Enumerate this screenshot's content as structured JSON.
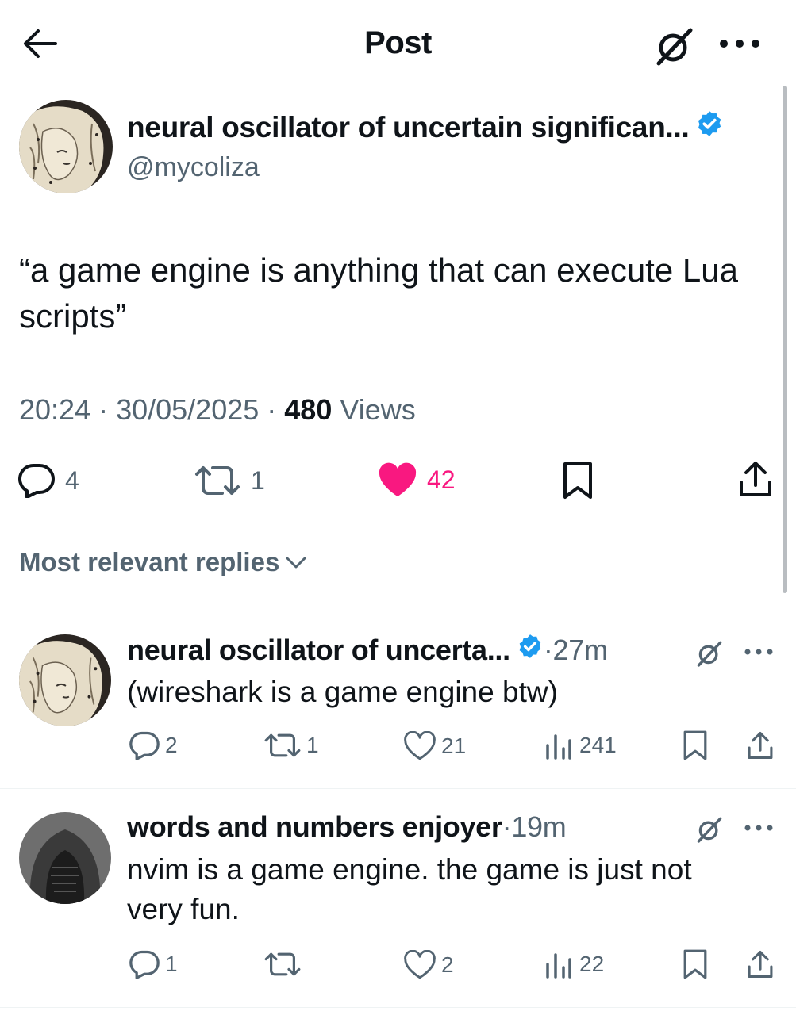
{
  "header": {
    "title": "Post"
  },
  "post": {
    "author_name": "neural oscillator of uncertain significan...",
    "handle": "@mycoliza",
    "text": "“a game engine is anything that can execute Lua scripts”",
    "time": "20:24",
    "sep1": " · ",
    "date": "30/05/2025",
    "sep2": " · ",
    "views_count": "480",
    "views_label": " Views",
    "replies": "4",
    "reposts": "1",
    "likes": "42",
    "like_color": "#f91880"
  },
  "replies_filter": {
    "label": "Most relevant replies"
  },
  "replies": [
    {
      "author_name": "neural oscillator of uncerta...",
      "verified": true,
      "dot": " · ",
      "time": "27m",
      "text": "(wireshark is a game engine btw)",
      "replies": "2",
      "reposts": "1",
      "likes": "21",
      "views": "241"
    },
    {
      "author_name": "words and numbers enjoyer",
      "verified": false,
      "dot": " · ",
      "time": "19m",
      "text": "nvim is a game engine. the game is just not very fun.",
      "replies": "1",
      "reposts": "",
      "likes": "2",
      "views": "22"
    }
  ],
  "colors": {
    "text": "#0f1419",
    "secondary": "#536471",
    "verified": "#1d9bf0",
    "like": "#f91880",
    "divider": "#eff3f4"
  }
}
